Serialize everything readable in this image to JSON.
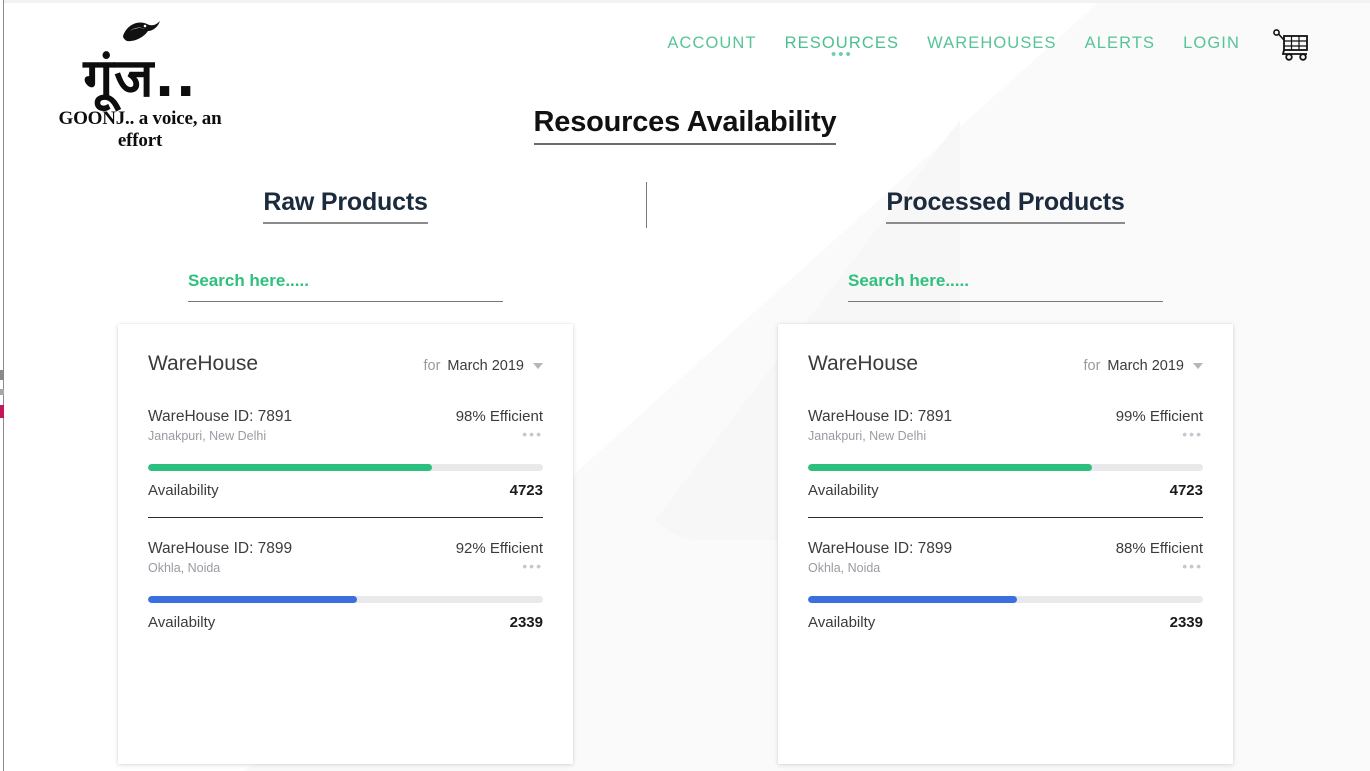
{
  "brand": {
    "logo_script": "गूंज..",
    "logo_bird": "🦅",
    "tagline": "GOONJ.. a voice, an effort"
  },
  "nav": {
    "items": [
      {
        "label": "ACCOUNT",
        "active": false
      },
      {
        "label": "RESOURCES",
        "active": true,
        "dots": "•••"
      },
      {
        "label": "WAREHOUSES",
        "active": false
      },
      {
        "label": "ALERTS",
        "active": false
      },
      {
        "label": "LOGIN",
        "active": false
      }
    ],
    "cart_icon": "shopping-cart-icon"
  },
  "page": {
    "title": "Resources Availability"
  },
  "colors": {
    "accent_green": "#2ec07d",
    "nav_green": "#57c498",
    "bar_green": "#2bc07d",
    "bar_blue": "#3b6fe0",
    "heading_navy": "#1b2a3d",
    "muted": "#9a9aa2"
  },
  "columns": [
    {
      "heading": "Raw Products",
      "search": {
        "placeholder": "Search here.....",
        "value": ""
      },
      "card": {
        "title": "WareHouse",
        "period_prefix": "for",
        "period": "March 2019",
        "entries": [
          {
            "id_label": "WareHouse ID: 7891",
            "location": "Janakpuri, New Delhi",
            "efficiency": "98% Efficient",
            "menu_dots": "•••",
            "bar_percent": 72,
            "bar_color": "#2bc07d",
            "availability_label": "Availability",
            "availability_value": "4723"
          },
          {
            "id_label": "WareHouse ID: 7899",
            "location": "Okhla, Noida",
            "efficiency": "92% Efficient",
            "menu_dots": "•••",
            "bar_percent": 53,
            "bar_color": "#3b6fe0",
            "availability_label": "Availabilty",
            "availability_value": "2339"
          }
        ]
      }
    },
    {
      "heading": "Processed Products",
      "search": {
        "placeholder": "Search here.....",
        "value": ""
      },
      "card": {
        "title": "WareHouse",
        "period_prefix": "for",
        "period": "March 2019",
        "entries": [
          {
            "id_label": "WareHouse ID: 7891",
            "location": "Janakpuri, New Delhi",
            "efficiency": "99% Efficient",
            "menu_dots": "•••",
            "bar_percent": 72,
            "bar_color": "#2bc07d",
            "availability_label": "Availability",
            "availability_value": "4723"
          },
          {
            "id_label": "WareHouse ID: 7899",
            "location": "Okhla, Noida",
            "efficiency": "88% Efficient",
            "menu_dots": "•••",
            "bar_percent": 53,
            "bar_color": "#3b6fe0",
            "availability_label": "Availabilty",
            "availability_value": "2339"
          }
        ]
      }
    }
  ]
}
